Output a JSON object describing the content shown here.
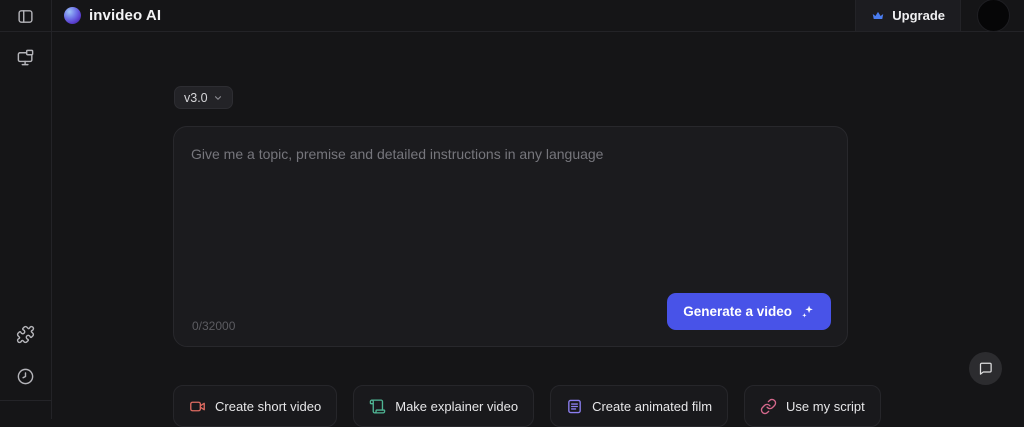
{
  "header": {
    "brand": "invideo AI",
    "upgrade_label": "Upgrade"
  },
  "sidebar": {
    "icons": [
      "panel-left-icon",
      "screen-share-icon",
      "puzzle-icon",
      "history-clock-icon"
    ]
  },
  "composer": {
    "version_label": "v3.0",
    "placeholder": "Give me a topic, premise and detailed instructions in any language",
    "prompt_value": "",
    "char_counter": "0/32000",
    "generate_label": "Generate a video",
    "generate_icon": "sparkles-icon"
  },
  "quick_actions": [
    {
      "label": "Create short video",
      "icon": "video-camera-icon",
      "icon_color": "#dd6a60"
    },
    {
      "label": "Make explainer video",
      "icon": "scroll-script-icon",
      "icon_color": "#4fb593"
    },
    {
      "label": "Create animated film",
      "icon": "document-lines-icon",
      "icon_color": "#8b7ef0"
    },
    {
      "label": "Use my script",
      "icon": "link-icon",
      "icon_color": "#d4688c"
    }
  ],
  "floating": {
    "chat_icon": "chat-bubble-icon"
  },
  "colors": {
    "background": "#151517",
    "panel": "#1b1b1e",
    "accent_blue": "#4853e8",
    "crown_blue": "#4a7cf0",
    "placeholder_text": "#76767c"
  }
}
